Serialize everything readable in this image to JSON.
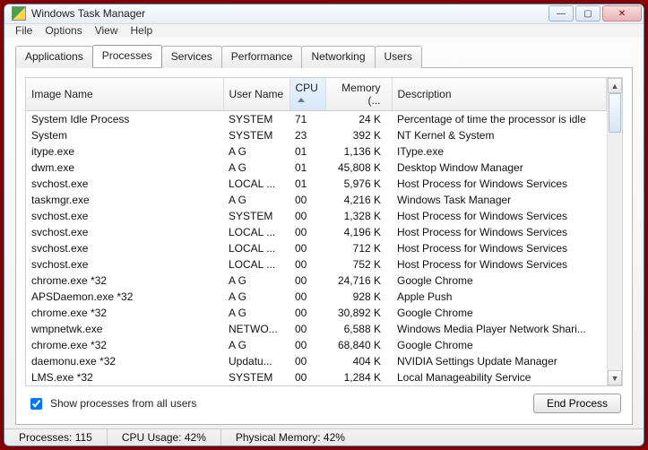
{
  "window": {
    "title": "Windows Task Manager"
  },
  "menu": {
    "file": "File",
    "options": "Options",
    "view": "View",
    "help": "Help"
  },
  "tabs": {
    "applications": "Applications",
    "processes": "Processes",
    "services": "Services",
    "performance": "Performance",
    "networking": "Networking",
    "users": "Users"
  },
  "columns": {
    "image": "Image Name",
    "user": "User Name",
    "cpu": "CPU",
    "memory": "Memory (...",
    "description": "Description"
  },
  "rows": [
    {
      "name": "System Idle Process",
      "user": "SYSTEM",
      "cpu": "71",
      "mem": "24 K",
      "desc": "Percentage of time the processor is idle"
    },
    {
      "name": "System",
      "user": "SYSTEM",
      "cpu": "23",
      "mem": "392 K",
      "desc": "NT Kernel & System"
    },
    {
      "name": "itype.exe",
      "user": "A G",
      "cpu": "01",
      "mem": "1,136 K",
      "desc": "IType.exe"
    },
    {
      "name": "dwm.exe",
      "user": "A G",
      "cpu": "01",
      "mem": "45,808 K",
      "desc": "Desktop Window Manager"
    },
    {
      "name": "svchost.exe",
      "user": "LOCAL ...",
      "cpu": "01",
      "mem": "5,976 K",
      "desc": "Host Process for Windows Services"
    },
    {
      "name": "taskmgr.exe",
      "user": "A G",
      "cpu": "00",
      "mem": "4,216 K",
      "desc": "Windows Task Manager"
    },
    {
      "name": "svchost.exe",
      "user": "SYSTEM",
      "cpu": "00",
      "mem": "1,328 K",
      "desc": "Host Process for Windows Services"
    },
    {
      "name": "svchost.exe",
      "user": "LOCAL ...",
      "cpu": "00",
      "mem": "4,196 K",
      "desc": "Host Process for Windows Services"
    },
    {
      "name": "svchost.exe",
      "user": "LOCAL ...",
      "cpu": "00",
      "mem": "712 K",
      "desc": "Host Process for Windows Services"
    },
    {
      "name": "svchost.exe",
      "user": "LOCAL ...",
      "cpu": "00",
      "mem": "752 K",
      "desc": "Host Process for Windows Services"
    },
    {
      "name": "chrome.exe *32",
      "user": "A G",
      "cpu": "00",
      "mem": "24,716 K",
      "desc": "Google Chrome"
    },
    {
      "name": "APSDaemon.exe *32",
      "user": "A G",
      "cpu": "00",
      "mem": "928 K",
      "desc": "Apple Push"
    },
    {
      "name": "chrome.exe *32",
      "user": "A G",
      "cpu": "00",
      "mem": "30,892 K",
      "desc": "Google Chrome"
    },
    {
      "name": "wmpnetwk.exe",
      "user": "NETWO...",
      "cpu": "00",
      "mem": "6,588 K",
      "desc": "Windows Media Player Network Shari..."
    },
    {
      "name": "chrome.exe *32",
      "user": "A G",
      "cpu": "00",
      "mem": "68,840 K",
      "desc": "Google Chrome"
    },
    {
      "name": "daemonu.exe *32",
      "user": "Updatu...",
      "cpu": "00",
      "mem": "404 K",
      "desc": "NVIDIA Settings Update Manager"
    },
    {
      "name": "LMS.exe *32",
      "user": "SYSTEM",
      "cpu": "00",
      "mem": "1,284 K",
      "desc": "Local Manageability Service"
    }
  ],
  "footer": {
    "checkbox": "Show processes from all users",
    "end": "End Process"
  },
  "status": {
    "processes": "Processes: 115",
    "cpu": "CPU Usage: 42%",
    "mem": "Physical Memory: 42%"
  }
}
